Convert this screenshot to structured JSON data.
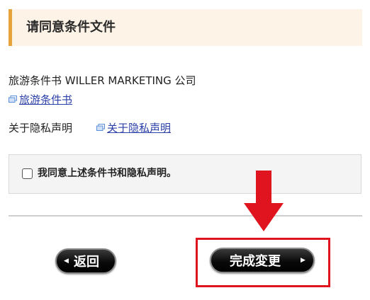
{
  "section": {
    "title": "请同意条件文件"
  },
  "terms": {
    "company_line": "旅游条件书 WILLER MARKETING 公司",
    "link_label": "旅游条件书"
  },
  "privacy": {
    "label": "关于隐私声明",
    "link_label": "关于隐私声明"
  },
  "agreement": {
    "checkbox_label": "我同意上述条件书和隐私声明。",
    "checked": false
  },
  "buttons": {
    "back_label": "返回",
    "complete_label": "完成変更"
  },
  "annotations": {
    "arrow_color": "#e0141e",
    "highlight_color": "#e0141e"
  },
  "colors": {
    "header_bg": "#fdf3e6",
    "header_accent": "#e8a23c",
    "link": "#2b3fa8"
  }
}
